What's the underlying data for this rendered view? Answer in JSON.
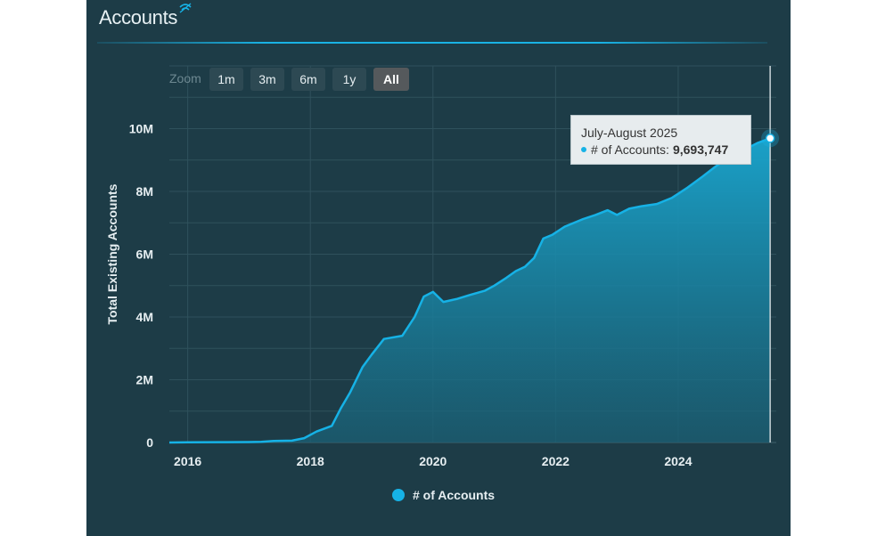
{
  "page": {
    "title": "Accounts",
    "colors": {
      "panel": "#1d3c47",
      "accent": "#16b2e6",
      "text": "#e6eef1"
    },
    "icons": {
      "title_icon": "chart-link-icon"
    }
  },
  "zoom": {
    "label": "Zoom",
    "buttons": [
      {
        "label": "1m",
        "active": false
      },
      {
        "label": "3m",
        "active": false
      },
      {
        "label": "6m",
        "active": false
      },
      {
        "label": "1y",
        "active": false
      },
      {
        "label": "All",
        "active": true
      }
    ]
  },
  "tooltip": {
    "header": "July-August 2025",
    "series_label": "# of Accounts:",
    "value_label": "9,693,747"
  },
  "chart_data": {
    "type": "area",
    "title": "Accounts",
    "ylabel": "Total Existing Accounts",
    "xlabel": "",
    "xlim": [
      2015.7,
      2025.6
    ],
    "ylim": [
      0,
      12000000
    ],
    "y_ticks": [
      0,
      2000000,
      4000000,
      6000000,
      8000000,
      10000000
    ],
    "y_tick_labels": [
      "0",
      "2M",
      "4M",
      "6M",
      "8M",
      "10M"
    ],
    "x_ticks": [
      2016,
      2018,
      2020,
      2022,
      2024
    ],
    "x_tick_labels": [
      "2016",
      "2018",
      "2020",
      "2022",
      "2024"
    ],
    "grid": true,
    "legend": "bottom-center",
    "series": [
      {
        "name": "# of Accounts",
        "color": "#16b2e6",
        "x": [
          2015.7,
          2016.0,
          2016.5,
          2017.0,
          2017.2,
          2017.4,
          2017.7,
          2017.9,
          2018.1,
          2018.35,
          2018.5,
          2018.65,
          2018.85,
          2019.0,
          2019.2,
          2019.5,
          2019.7,
          2019.85,
          2020.0,
          2020.17,
          2020.4,
          2020.6,
          2020.85,
          2021.0,
          2021.2,
          2021.35,
          2021.5,
          2021.65,
          2021.8,
          2021.95,
          2022.15,
          2022.45,
          2022.65,
          2022.85,
          2023.0,
          2023.2,
          2023.4,
          2023.65,
          2023.9,
          2024.15,
          2024.4,
          2024.6,
          2024.85,
          2025.1,
          2025.3,
          2025.5
        ],
        "values": [
          0,
          5000,
          10000,
          15000,
          20000,
          50000,
          60000,
          140000,
          350000,
          530000,
          1100000,
          1600000,
          2400000,
          2800000,
          3300000,
          3400000,
          4000000,
          4650000,
          4800000,
          4480000,
          4580000,
          4700000,
          4840000,
          5000000,
          5250000,
          5460000,
          5600000,
          5880000,
          6500000,
          6620000,
          6880000,
          7120000,
          7250000,
          7400000,
          7250000,
          7450000,
          7530000,
          7600000,
          7800000,
          8120000,
          8480000,
          8780000,
          9120000,
          9350000,
          9550000,
          9693747
        ]
      }
    ],
    "highlight": {
      "label": "July-August 2025",
      "x": 2025.5,
      "value": 9693747
    }
  }
}
